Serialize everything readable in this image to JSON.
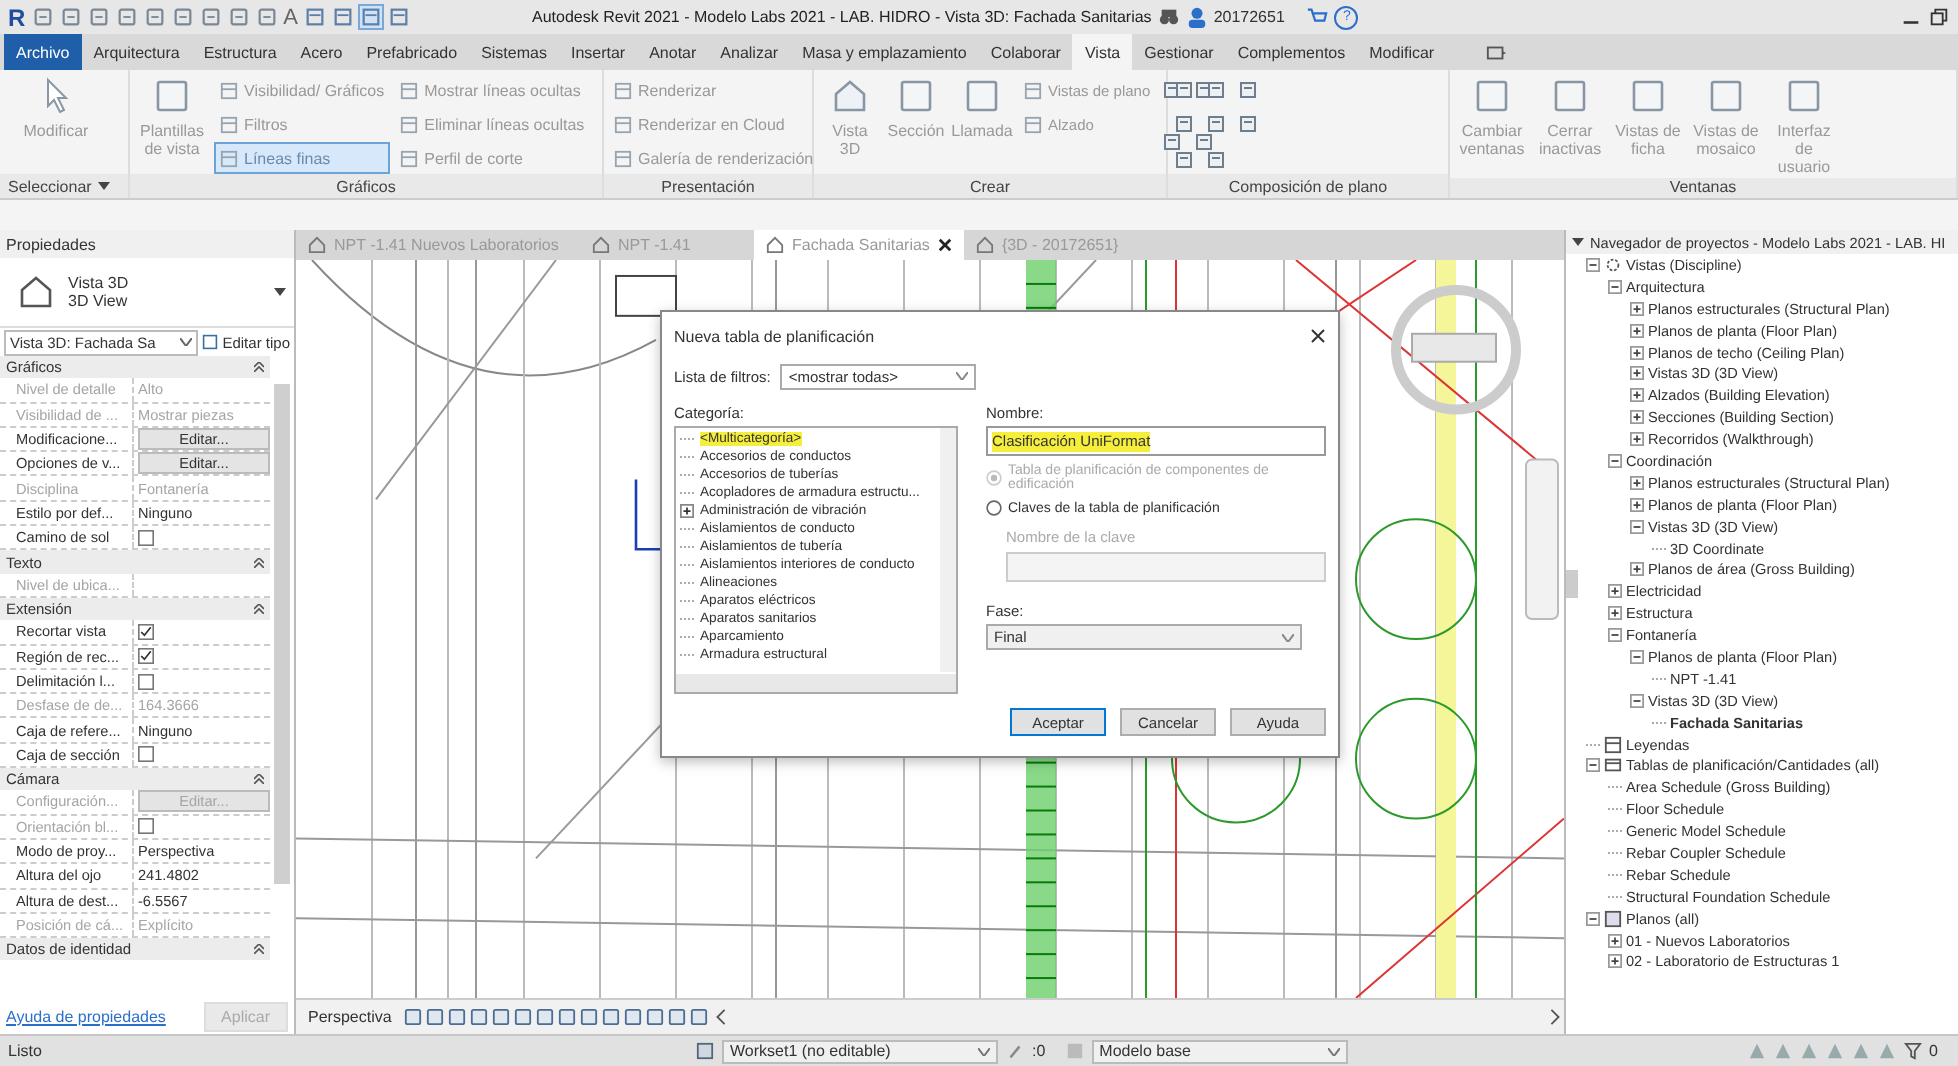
{
  "title_bar": {
    "logo": "R",
    "text_tool": "A",
    "title": "Autodesk Revit 2021 - Modelo Labs 2021 - LAB. HIDRO - Vista 3D: Fachada Sanitarias",
    "user": "20172651",
    "help": "?"
  },
  "menu_tabs": [
    {
      "label": "Archivo",
      "kind": "file",
      "selected": false
    },
    {
      "label": "Arquitectura",
      "kind": "tab",
      "selected": false
    },
    {
      "label": "Estructura",
      "kind": "tab",
      "selected": false
    },
    {
      "label": "Acero",
      "kind": "tab",
      "selected": false
    },
    {
      "label": "Prefabricado",
      "kind": "tab",
      "selected": false
    },
    {
      "label": "Sistemas",
      "kind": "tab",
      "selected": false
    },
    {
      "label": "Insertar",
      "kind": "tab",
      "selected": false
    },
    {
      "label": "Anotar",
      "kind": "tab",
      "selected": false
    },
    {
      "label": "Analizar",
      "kind": "tab",
      "selected": false
    },
    {
      "label": "Masa y emplazamiento",
      "kind": "tab",
      "selected": false
    },
    {
      "label": "Colaborar",
      "kind": "tab",
      "selected": false
    },
    {
      "label": "Vista",
      "kind": "tab",
      "selected": true
    },
    {
      "label": "Gestionar",
      "kind": "tab",
      "selected": false
    },
    {
      "label": "Complementos",
      "kind": "tab",
      "selected": false
    },
    {
      "label": "Modificar",
      "kind": "tab",
      "selected": false
    }
  ],
  "ribbon": [
    {
      "title": "Seleccionar",
      "dropdown": true,
      "groups": [
        {
          "kind": "large",
          "tools": [
            {
              "label": "Modificar"
            }
          ]
        }
      ]
    },
    {
      "title": "Gráficos",
      "dropdown": false,
      "groups": [
        {
          "kind": "large",
          "tools": [
            {
              "label": "Plantillas de vista"
            }
          ]
        },
        {
          "kind": "stack",
          "tools": [
            {
              "label": "Visibilidad/ Gráficos",
              "on": false
            },
            {
              "label": "Filtros",
              "on": false
            },
            {
              "label": "Líneas finas",
              "on": true
            }
          ]
        },
        {
          "kind": "stack",
          "tools": [
            {
              "label": "Mostrar líneas ocultas",
              "on": false
            },
            {
              "label": "Eliminar líneas ocultas",
              "on": false
            },
            {
              "label": "Perfil de corte",
              "on": false
            }
          ]
        }
      ]
    },
    {
      "title": "Presentación",
      "dropdown": false,
      "groups": [
        {
          "kind": "stack",
          "tools": [
            {
              "label": "Renderizar",
              "on": false
            },
            {
              "label": "Renderizar  en Cloud",
              "on": false
            },
            {
              "label": "Galería de  renderización",
              "on": false
            }
          ]
        }
      ]
    },
    {
      "title": "Crear",
      "dropdown": false,
      "groups": [
        {
          "kind": "large",
          "tools": [
            {
              "label": "Vista 3D"
            },
            {
              "label": "Sección"
            },
            {
              "label": "Llamada"
            }
          ]
        },
        {
          "kind": "stack",
          "tools": [
            {
              "label": "Vistas de plano",
              "on": false
            },
            {
              "label": "Alzado",
              "on": false
            }
          ]
        },
        {
          "kind": "icons"
        }
      ]
    },
    {
      "title": "Composición de plano",
      "dropdown": false,
      "groups": [
        {
          "kind": "icons"
        }
      ]
    },
    {
      "title": "Ventanas",
      "dropdown": false,
      "groups": [
        {
          "kind": "large",
          "tools": [
            {
              "label": "Cambiar ventanas"
            },
            {
              "label": "Cerrar inactivas"
            },
            {
              "label": "Vistas de ficha"
            },
            {
              "label": "Vistas de mosaico"
            },
            {
              "label": "Interfaz de usuario"
            }
          ]
        }
      ]
    }
  ],
  "properties": {
    "title": "Propiedades",
    "type_name": "Vista 3D",
    "type_sub": "3D View",
    "selector": "Vista 3D: Fachada Sa",
    "edit_type": "Editar tipo",
    "groups": [
      {
        "title": "Gráficos",
        "rows": [
          {
            "label": "Nivel de detalle",
            "value": "Alto",
            "kind": "text",
            "disabled": true
          },
          {
            "label": "Visibilidad de ...",
            "value": "Mostrar piezas",
            "kind": "text",
            "disabled": true
          },
          {
            "label": "Modificacione...",
            "value": "Editar...",
            "kind": "button",
            "disabled": false
          },
          {
            "label": "Opciones de v...",
            "value": "Editar...",
            "kind": "button",
            "disabled": false
          },
          {
            "label": "Disciplina",
            "value": "Fontanería",
            "kind": "text",
            "disabled": true
          },
          {
            "label": "Estilo por def...",
            "value": "Ninguno",
            "kind": "text",
            "disabled": false
          },
          {
            "label": "Camino de sol",
            "kind": "check",
            "checked": false,
            "disabled": false
          }
        ]
      },
      {
        "title": "Texto",
        "rows": [
          {
            "label": "Nivel de ubica...",
            "kind": "text",
            "disabled": true
          }
        ]
      },
      {
        "title": "Extensión",
        "rows": [
          {
            "label": "Recortar vista",
            "kind": "check",
            "checked": true,
            "disabled": false
          },
          {
            "label": "Región de rec...",
            "kind": "check",
            "checked": true,
            "disabled": false
          },
          {
            "label": "Delimitación l...",
            "kind": "check",
            "checked": false,
            "disabled": false
          },
          {
            "label": "Desfase de de...",
            "value": "164.3666",
            "kind": "text",
            "disabled": true
          },
          {
            "label": "Caja de refere...",
            "value": "Ninguno",
            "kind": "text",
            "disabled": false
          },
          {
            "label": "Caja de sección",
            "kind": "check",
            "checked": false,
            "disabled": false
          }
        ]
      },
      {
        "title": "Cámara",
        "rows": [
          {
            "label": "Configuración...",
            "value": "Editar...",
            "kind": "button",
            "disabled": true
          },
          {
            "label": "Orientación bl...",
            "kind": "check",
            "checked": false,
            "disabled": true
          },
          {
            "label": "Modo de proy...",
            "value": "Perspectiva",
            "kind": "text",
            "disabled": false
          },
          {
            "label": "Altura del ojo",
            "value": "241.4802",
            "kind": "text",
            "disabled": false
          },
          {
            "label": "Altura de dest...",
            "value": "-6.5567",
            "kind": "text",
            "disabled": false
          },
          {
            "label": "Posición de cá...",
            "value": "Explícito",
            "kind": "text",
            "disabled": true
          }
        ]
      },
      {
        "title": "Datos de identidad"
      }
    ],
    "help_link": "Ayuda de propiedades",
    "apply": "Aplicar"
  },
  "view_tabs": [
    {
      "label": "NPT -1.41 Nuevos Laboratorios",
      "selected": false
    },
    {
      "label": "NPT -1.41",
      "selected": false
    },
    {
      "label": "Fachada Sanitarias",
      "selected": true
    },
    {
      "label": "{3D - 20172651}",
      "selected": false
    }
  ],
  "view_bar": {
    "mode": "Perspectiva"
  },
  "dialog": {
    "title": "Nueva tabla de planificación",
    "filter_label": "Lista de filtros:",
    "filter_value": "<mostrar todas>",
    "category_label": "Categoría:",
    "categories": [
      {
        "label": "<Multicategoría>",
        "selected": true
      },
      {
        "label": "Accesorios de conductos",
        "selected": false
      },
      {
        "label": "Accesorios de tuberías",
        "selected": false
      },
      {
        "label": "Acopladores de armadura estructu...",
        "selected": false
      },
      {
        "label": "Administración de vibración",
        "selected": false,
        "expanded": false
      },
      {
        "label": "Aislamientos de conducto",
        "selected": false
      },
      {
        "label": "Aislamientos de tubería",
        "selected": false
      },
      {
        "label": "Aislamientos interiores de conducto",
        "selected": false
      },
      {
        "label": "Alineaciones",
        "selected": false
      },
      {
        "label": "Aparatos eléctricos",
        "selected": false
      },
      {
        "label": "Aparatos sanitarios",
        "selected": false
      },
      {
        "label": "Aparcamiento",
        "selected": false
      },
      {
        "label": "Armadura estructural",
        "selected": false
      }
    ],
    "name_label": "Nombre:",
    "name_value": "Clasificación UniFormat",
    "options": [
      {
        "label": "Tabla de planificación de componentes de edificación",
        "checked": true,
        "disabled": true
      },
      {
        "label": "Claves de la tabla de planificación",
        "checked": false,
        "disabled": false
      }
    ],
    "key_label": "Nombre de la clave",
    "phase_label": "Fase:",
    "phase_value": "Final",
    "buttons": [
      {
        "label": "Aceptar",
        "default": true
      },
      {
        "label": "Cancelar",
        "default": false
      },
      {
        "label": "Ayuda",
        "default": false
      }
    ]
  },
  "browser": {
    "title": "Navegador de proyectos - Modelo Labs 2021 - LAB. HI",
    "tree": [
      {
        "label": "Vistas (Discipline)",
        "kind": "views",
        "expanded": true,
        "selected": false,
        "children": [
          {
            "label": "Arquitectura",
            "expanded": true,
            "selected": false,
            "children": [
              {
                "label": "Planos estructurales (Structural Plan)",
                "expanded": false,
                "selected": false
              },
              {
                "label": "Planos de planta (Floor Plan)",
                "expanded": false,
                "selected": false
              },
              {
                "label": "Planos de techo (Ceiling Plan)",
                "expanded": false,
                "selected": false
              },
              {
                "label": "Vistas 3D (3D View)",
                "expanded": false,
                "selected": false
              },
              {
                "label": "Alzados (Building Elevation)",
                "expanded": false,
                "selected": false
              },
              {
                "label": "Secciones (Building Section)",
                "expanded": false,
                "selected": false
              },
              {
                "label": "Recorridos (Walkthrough)",
                "expanded": false,
                "selected": false
              }
            ]
          },
          {
            "label": "Coordinación",
            "expanded": true,
            "selected": false,
            "children": [
              {
                "label": "Planos estructurales (Structural Plan)",
                "expanded": false,
                "selected": false
              },
              {
                "label": "Planos de planta (Floor Plan)",
                "expanded": false,
                "selected": false
              },
              {
                "label": "Vistas 3D (3D View)",
                "expanded": true,
                "selected": false,
                "children": [
                  {
                    "label": "3D Coordinate",
                    "selected": false
                  }
                ]
              },
              {
                "label": "Planos de área (Gross Building)",
                "expanded": false,
                "selected": false
              }
            ]
          },
          {
            "label": "Electricidad",
            "expanded": false,
            "selected": false
          },
          {
            "label": "Estructura",
            "expanded": false,
            "selected": false
          },
          {
            "label": "Fontanería",
            "expanded": true,
            "selected": false,
            "children": [
              {
                "label": "Planos de planta (Floor Plan)",
                "expanded": true,
                "selected": false,
                "children": [
                  {
                    "label": "NPT -1.41",
                    "selected": false
                  }
                ]
              },
              {
                "label": "Vistas 3D (3D View)",
                "expanded": true,
                "selected": false,
                "children": [
                  {
                    "label": "Fachada Sanitarias",
                    "selected": true
                  }
                ]
              }
            ]
          }
        ]
      },
      {
        "label": "Leyendas",
        "kind": "legends",
        "selected": false
      },
      {
        "label": "Tablas de planificación/Cantidades (all)",
        "kind": "schedules",
        "expanded": true,
        "selected": false,
        "children": [
          {
            "label": "Area Schedule (Gross Building)",
            "selected": false
          },
          {
            "label": "Floor Schedule",
            "selected": false
          },
          {
            "label": "Generic Model Schedule",
            "selected": false
          },
          {
            "label": "Rebar Coupler Schedule",
            "selected": false
          },
          {
            "label": "Rebar Schedule",
            "selected": false
          },
          {
            "label": "Structural Foundation Schedule",
            "selected": false
          }
        ]
      },
      {
        "label": "Planos (all)",
        "kind": "sheets",
        "expanded": true,
        "selected": false,
        "children": [
          {
            "label": "01 - Nuevos Laboratorios",
            "expanded": false,
            "selected": false
          },
          {
            "label": "02 - Laboratorio de Estructuras 1",
            "expanded": false,
            "selected": false
          }
        ]
      }
    ]
  },
  "status_bar": {
    "status": "Listo",
    "workset": "Workset1 (no editable)",
    "workset_count": ":0",
    "model": "Modelo base",
    "filter_count": "0"
  }
}
